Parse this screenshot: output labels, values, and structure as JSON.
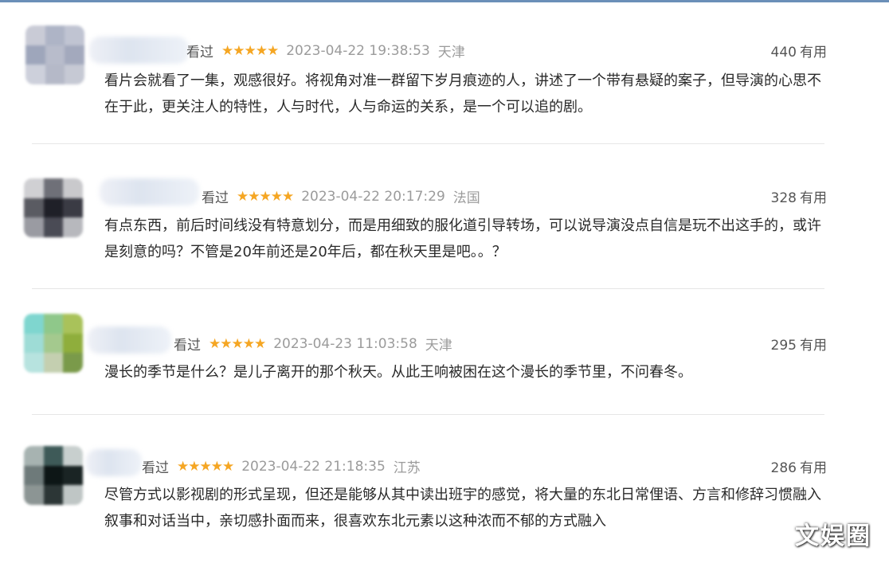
{
  "reviews": [
    {
      "status": "看过",
      "stars": "★★★★★",
      "datetime": "2023-04-22 19:38:53",
      "location": "天津",
      "useful_count": "440",
      "useful_label": "有用",
      "content": "看片会就看了一集，观感很好。将视角对准一群留下岁月痕迹的人，讲述了一个带有悬疑的案子，但导演的心思不在于此，更关注人的特性，人与时代，人与命运的关系，是一个可以追的剧。",
      "avatar_colors": [
        "#c9cbd6",
        "#aeb4c6",
        "#c0c4d2",
        "#9ea6bb",
        "#b8bccb",
        "#a3a9bd",
        "#cdd0db",
        "#b5b9c8",
        "#c6c9d4"
      ]
    },
    {
      "status": "看过",
      "stars": "★★★★★",
      "datetime": "2023-04-22 20:17:29",
      "location": "法国",
      "useful_count": "328",
      "useful_label": "有用",
      "content": "有点东西，前后时间线没有特意划分，而是用细致的服化道引导转场，可以说导演没点自信是玩不出这手的，或许是刻意的吗？不管是20年前还是20年后，都在秋天里是吧。。？",
      "avatar_colors": [
        "#d0d0d3",
        "#6f7078",
        "#c9c9cc",
        "#5a5b62",
        "#1f2028",
        "#3a3b44",
        "#9a9ba2",
        "#4a4b55",
        "#b7b8bd"
      ]
    },
    {
      "status": "看过",
      "stars": "★★★★★",
      "datetime": "2023-04-23 11:03:58",
      "location": "天津",
      "useful_count": "295",
      "useful_label": "有用",
      "content": "漫长的季节是什么？是儿子离开的那个秋天。从此王响被困在这个漫长的季节里，不问春冬。",
      "avatar_colors": [
        "#7fd6cf",
        "#8fc88a",
        "#a9c25a",
        "#9edcd6",
        "#a4c98e",
        "#8fae3c",
        "#b7e3df",
        "#c4cfb0",
        "#7a9a4a"
      ]
    },
    {
      "status": "看过",
      "stars": "★★★★★",
      "datetime": "2023-04-22 21:18:35",
      "location": "江苏",
      "useful_count": "286",
      "useful_label": "有用",
      "content": "尽管方式以影视剧的形式呈现，但还是能够从其中读出班宇的感觉，将大量的东北日常俚语、方言和修辞习惯融入叙事和对话当中，亲切感扑面而来，很喜欢东北元素以这种浓而不郁的方式融入",
      "avatar_colors": [
        "#a7b3b1",
        "#3e5a58",
        "#c8cfce",
        "#6e7a7a",
        "#0d1616",
        "#1a2424",
        "#8c9594",
        "#2c3636",
        "#bfc6c5"
      ]
    }
  ],
  "watermark": "文娱圈"
}
